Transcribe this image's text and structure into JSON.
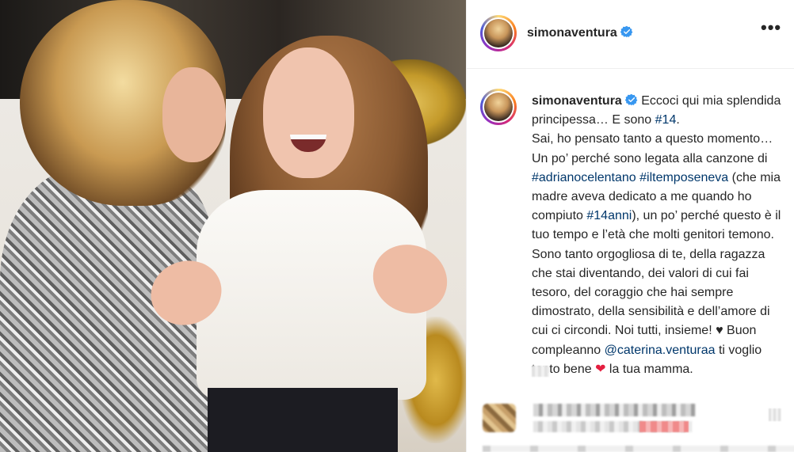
{
  "post": {
    "image_alt": "Photo of a smiling girl with long brown hair in a white blouse next to a woman in a sequined jacket"
  },
  "header": {
    "username": "simonaventura",
    "more_label": "•••"
  },
  "caption": {
    "username": "simonaventura",
    "segments": {
      "s1": " Eccoci qui mia splendida principessa… E sono ",
      "tag14": "#14",
      "s2": ".\nSai, ho pensato tanto a questo momento… Un po’ perché sono legata alla canzone di ",
      "tagCelentano": "#adrianocelentano",
      "space1": " ",
      "tagTempo": "#iltemposeneva",
      "s3": " (che mia madre aveva dedicato a me quando ho compiuto ",
      "tag14anni": "#14anni",
      "s4": "), un po’ perché questo è il tuo tempo e l’età che molti genitori temono. Sono tanto orgogliosa di te, della ragazza che stai diventando, dei valori di cui fai tesoro, del coraggio che hai sempre dimostrato, della sensibilità e dell’amore di cui ci circondi. Noi tutti, insieme! ",
      "heart_black": "♥",
      "s5": " Buon compleanno ",
      "mention": "@caterina.venturaa",
      "s6": " ti voglio tanto bene ",
      "heart_red": "❤",
      "s7": " la tua mamma."
    }
  },
  "colors": {
    "link": "#00376b",
    "verified": "#3897f0",
    "text": "#262626",
    "border": "#efefef"
  },
  "icons": {
    "verified": "verified-badge-icon",
    "more": "more-options-icon"
  }
}
